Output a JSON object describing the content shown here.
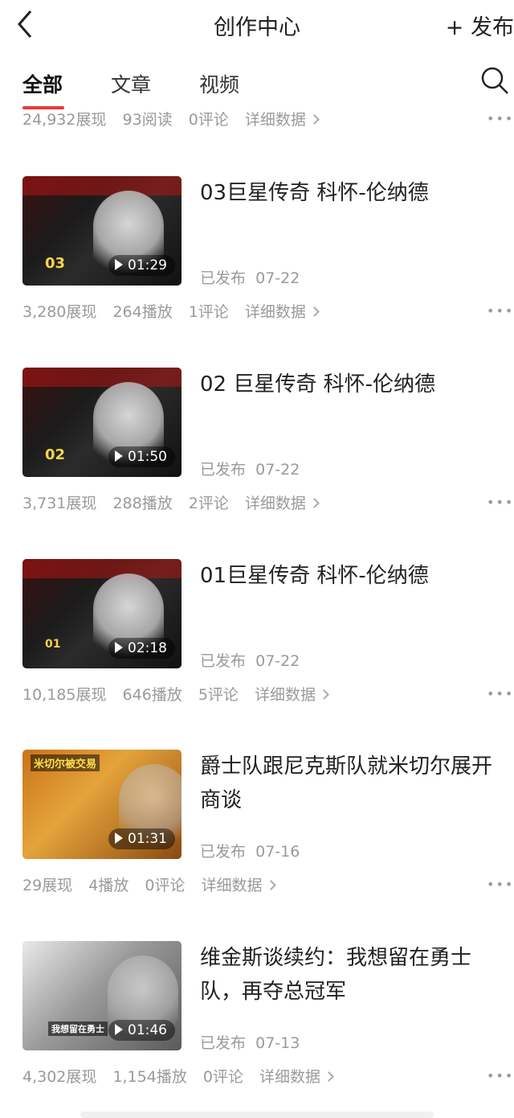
{
  "header": {
    "title": "创作中心",
    "publish_label": "+ 发布"
  },
  "tabs": [
    {
      "label": "全部"
    },
    {
      "label": "文章"
    },
    {
      "label": "视频"
    }
  ],
  "top_partial": {
    "impressions": "24,932展现",
    "reads": "93阅读",
    "comments": "0评论",
    "details": "详细数据"
  },
  "items": [
    {
      "title": "03巨星传奇 科怀-伦纳德",
      "thumb_tag": "03",
      "duration": "01:29",
      "status": "已发布",
      "date": "07-22",
      "impressions": "3,280展现",
      "plays": "264播放",
      "comments": "1评论",
      "details": "详细数据"
    },
    {
      "title": "02 巨星传奇 科怀-伦纳德",
      "thumb_tag": "02",
      "duration": "01:50",
      "status": "已发布",
      "date": "07-22",
      "impressions": "3,731展现",
      "plays": "288播放",
      "comments": "2评论",
      "details": "详细数据"
    },
    {
      "title": "01巨星传奇 科怀-伦纳德",
      "thumb_tag": "01",
      "duration": "02:18",
      "status": "已发布",
      "date": "07-22",
      "impressions": "10,185展现",
      "plays": "646播放",
      "comments": "5评论",
      "details": "详细数据"
    },
    {
      "title": "爵士队跟尼克斯队就米切尔展开商谈",
      "thumb_tag": "米切尔被交易",
      "duration": "01:31",
      "status": "已发布",
      "date": "07-16",
      "impressions": "29展现",
      "plays": "4播放",
      "comments": "0评论",
      "details": "详细数据"
    },
    {
      "title": "维金斯谈续约：我想留在勇士队，再夺总冠军",
      "thumb_tag": "我想留在勇士",
      "duration": "01:46",
      "status": "已发布",
      "date": "07-13",
      "impressions": "4,302展现",
      "plays": "1,154播放",
      "comments": "0评论",
      "details": "详细数据"
    }
  ],
  "colors": {
    "accent": "#e8383b",
    "muted_text": "#9a9a9a"
  },
  "icons": {
    "back": "chevron-left-icon",
    "search": "search-icon",
    "more": "more-dots-icon",
    "play": "play-icon"
  }
}
